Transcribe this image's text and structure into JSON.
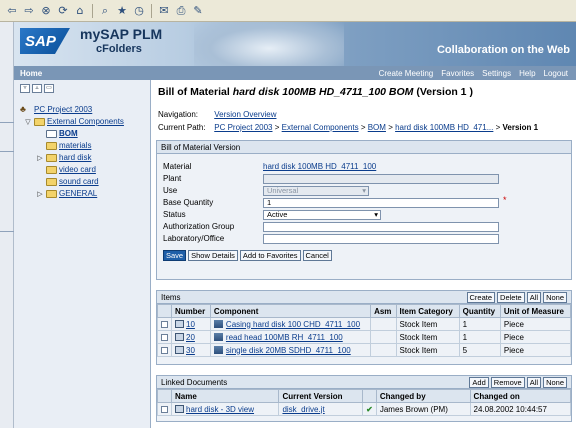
{
  "header": {
    "logo": "SAP",
    "brand_line1": "mySAP PLM",
    "brand_line2": "cFolders",
    "tagline": "Collaboration on the Web"
  },
  "nav": {
    "home": "Home",
    "links": [
      "Create Meeting",
      "Favorites",
      "Settings",
      "Help",
      "Logout"
    ]
  },
  "tree": {
    "root": "PC Project 2003",
    "external": "External Components",
    "bom": "BOM",
    "materials": "materials",
    "hard_disk": "hard disk",
    "video_card": "video card",
    "sound_card": "sound card",
    "general": "GENERAL"
  },
  "main": {
    "title_prefix": "Bill of Material ",
    "title_name": "hard disk 100MB HD_4711_100 BOM",
    "title_suffix": " (Version 1 )",
    "navigation_label": "Navigation:",
    "navigation_link": "Version Overview",
    "path_label": "Current Path:",
    "path": [
      "PC Project 2003",
      "External Components",
      "BOM",
      "hard disk 100MB HD_471..."
    ],
    "path_sep": ">",
    "path_current": "Version 1"
  },
  "form": {
    "section_title": "Bill of Material Version",
    "fields": {
      "material_label": "Material",
      "material_value": "hard disk 100MB HD_4711_100",
      "plant_label": "Plant",
      "use_label": "Use",
      "use_value": "Universal",
      "base_qty_label": "Base Quantity",
      "base_qty_value": "1",
      "status_label": "Status",
      "status_value": "Active",
      "auth_label": "Authorization Group",
      "lab_label": "Laboratory/Office"
    },
    "required_mark": "*",
    "buttons": [
      "Save",
      "Show Details",
      "Add to Favorites",
      "Cancel"
    ]
  },
  "items": {
    "title": "Items",
    "buttons": [
      "Create",
      "Delete",
      "All",
      "None"
    ],
    "columns": [
      "Number",
      "Component",
      "Asm",
      "Item Category",
      "Quantity",
      "Unit of Measure"
    ],
    "rows": [
      {
        "number": "10",
        "component": "Casing hard disk 100 CHD_4711_100",
        "asm": "",
        "category": "Stock Item",
        "qty": "1",
        "unit": "Piece"
      },
      {
        "number": "20",
        "component": "read head 100MB RH_4711_100",
        "asm": "",
        "category": "Stock Item",
        "qty": "1",
        "unit": "Piece"
      },
      {
        "number": "30",
        "component": "single disk 20MB SDHD_4711_100",
        "asm": "",
        "category": "Stock Item",
        "qty": "5",
        "unit": "Piece"
      }
    ]
  },
  "docs": {
    "title": "Linked Documents",
    "buttons": [
      "Add",
      "Remove",
      "All",
      "None"
    ],
    "columns": [
      "Name",
      "Current Version",
      "",
      "Changed by",
      "Changed on"
    ],
    "rows": [
      {
        "name": "hard disk - 3D view",
        "version": "disk_drive.jt",
        "check": "✔",
        "changed_by": "James Brown (PM)",
        "changed_on": "24.08.2002 10:44:57"
      }
    ]
  }
}
